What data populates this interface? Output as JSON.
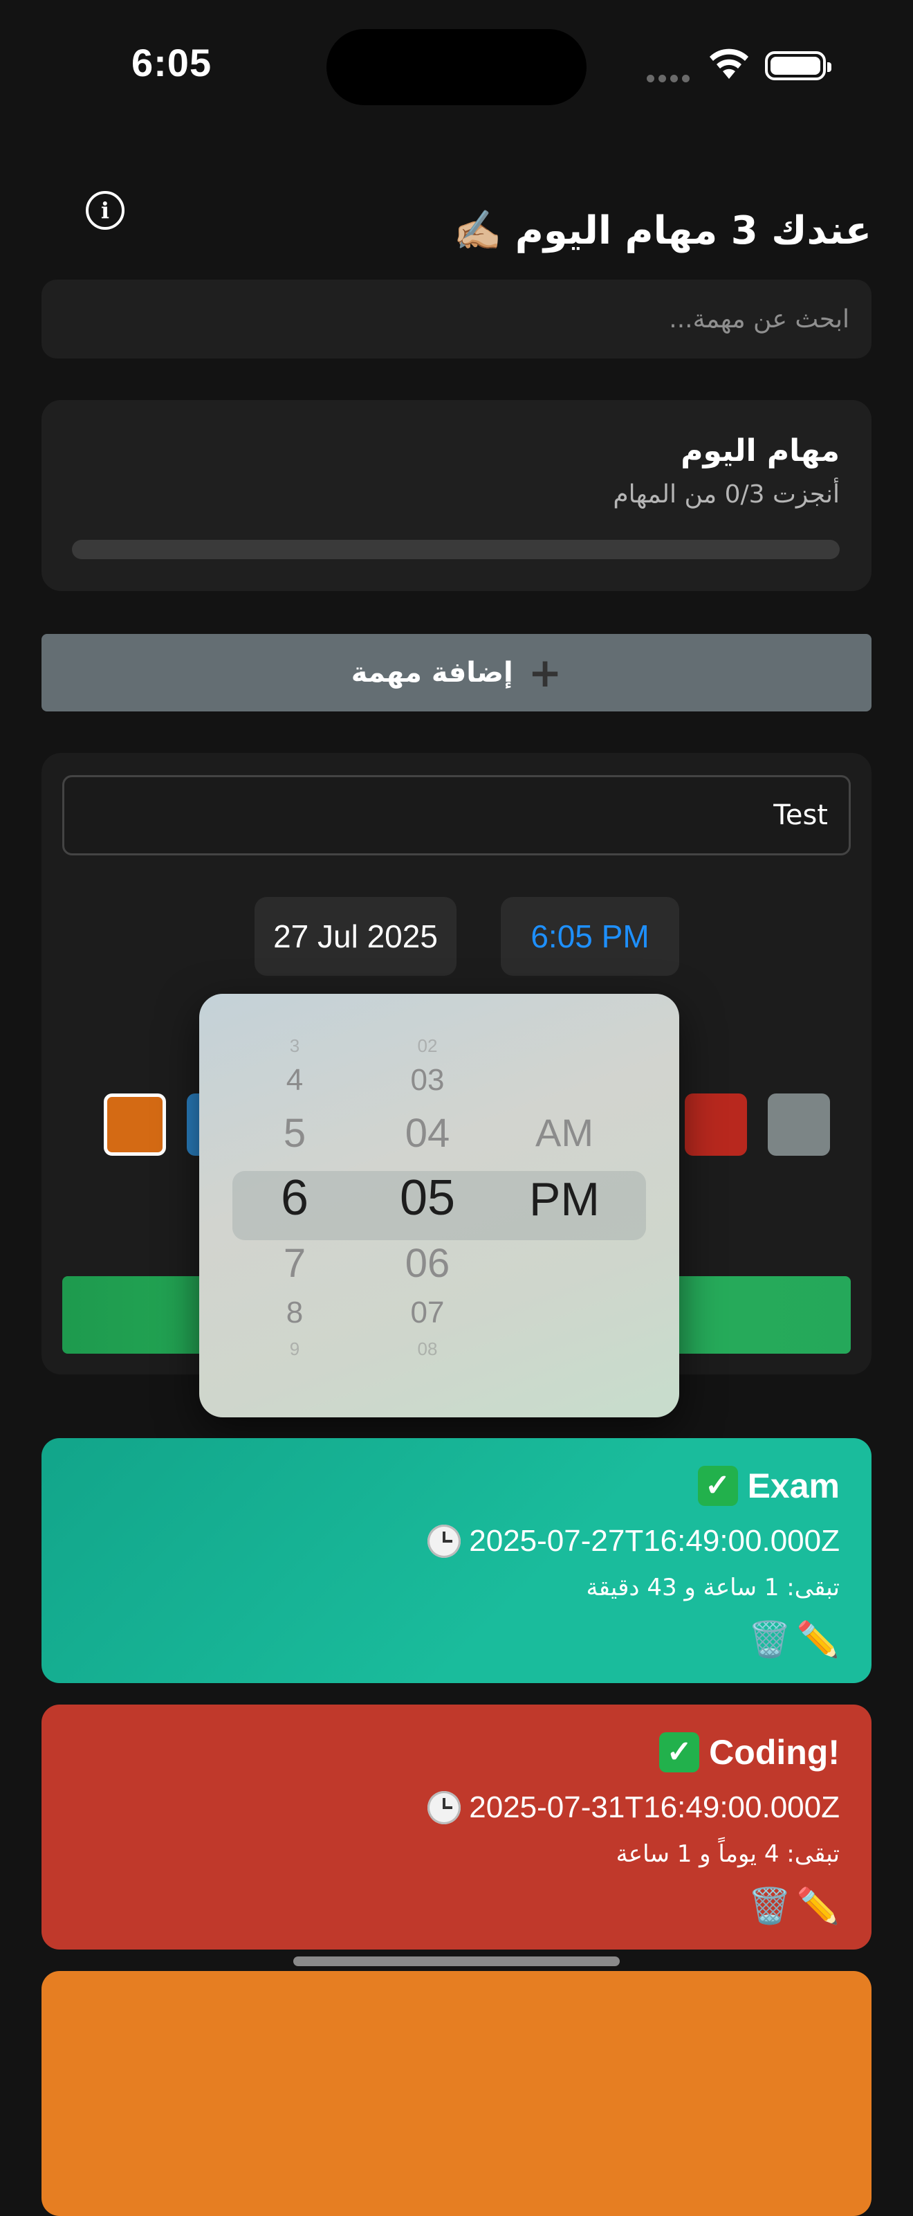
{
  "status_bar": {
    "time": "6:05"
  },
  "header": {
    "title": "عندك 3 مهام اليوم ✍🏼"
  },
  "search": {
    "placeholder": "ابحث عن مهمة..."
  },
  "progress": {
    "title": "مهام اليوم",
    "subtitle": "أنجزت 0/3 من المهام",
    "completed": 0,
    "total": 3
  },
  "add_button": {
    "icon": "plus-icon",
    "label": "إضافة مهمة"
  },
  "form": {
    "task_name": "Test",
    "date": "27 Jul 2025",
    "time": "6:05 PM",
    "colors": [
      "#d46a14",
      "#2a7fc0",
      "#b8281e",
      "#7c8586"
    ],
    "selected_color": "#d46a14"
  },
  "time_picker": {
    "hours": [
      "3",
      "4",
      "5",
      "6",
      "7",
      "8",
      "9"
    ],
    "minutes": [
      "02",
      "03",
      "04",
      "05",
      "06",
      "07",
      "08"
    ],
    "periods": [
      "AM",
      "PM"
    ],
    "selected": {
      "hour": "6",
      "minute": "05",
      "period": "PM"
    }
  },
  "tasks": [
    {
      "title": "Exam",
      "datetime": "2025-07-27T16:49:00.000Z",
      "remaining": "تبقى: 1 ساعة و 43 دقيقة",
      "color": "#1aac8c",
      "done_icon": "check-icon",
      "edit_icon": "pencil-icon",
      "delete_icon": "trash-icon",
      "edit_glyph": "✏️",
      "delete_glyph": "🗑️"
    },
    {
      "title": "Coding!",
      "datetime": "2025-07-31T16:49:00.000Z",
      "remaining": "تبقى: 4 يوماً و 1 ساعة",
      "color": "#c0392b",
      "done_icon": "check-icon",
      "edit_icon": "pencil-icon",
      "delete_icon": "trash-icon",
      "edit_glyph": "✏️",
      "delete_glyph": "🗑️"
    },
    {
      "color": "#e67e22"
    }
  ],
  "colors": {
    "background": "#131313",
    "card": "#1f1f1f",
    "accent_time": "#1e90ff",
    "submit_green": "#27ae60",
    "add_button": "#646e73"
  }
}
